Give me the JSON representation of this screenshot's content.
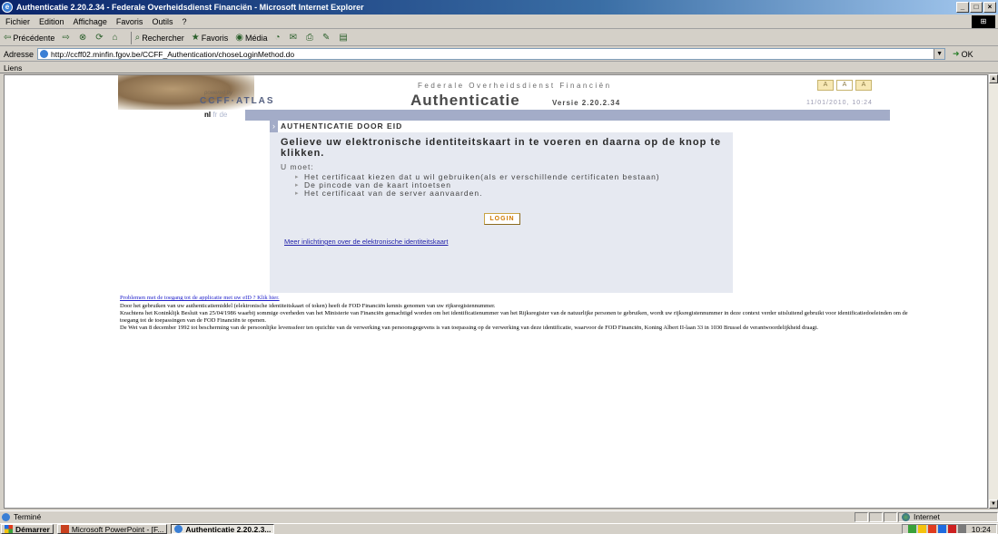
{
  "window": {
    "title": "Authenticatie 2.20.2.34 - Federale Overheidsdienst Financiën - Microsoft Internet Explorer",
    "controls": [
      "_",
      "□",
      "×"
    ]
  },
  "menu": [
    "Fichier",
    "Edition",
    "Affichage",
    "Favoris",
    "Outils",
    "?"
  ],
  "toolbar": {
    "back": "Précédente",
    "search": "Rechercher",
    "favorites": "Favoris",
    "media": "Média"
  },
  "address": {
    "label": "Adresse",
    "url": "http://ccff02.minfin.fgov.be/CCFF_Authentication/choseLoginMethod.do",
    "go": "OK"
  },
  "links_label": "Liens",
  "banner": {
    "powered_by": "powered by",
    "brand": "CCFF·ATLAS",
    "agency": "Federale Overheidsdienst Financiën",
    "title": "Authenticatie",
    "version": "Versie 2.20.2.34",
    "font_sizes": [
      "A",
      "A",
      "A"
    ],
    "date": "11/01/2010, 10:24",
    "languages": {
      "nl": "nl",
      "fr": "fr",
      "de": "de"
    }
  },
  "panel": {
    "title": "AUTHENTICATIE DOOR EID",
    "instruction": "Gelieve uw elektronische identiteitskaart in te voeren en daarna op de knop te klikken.",
    "must_label": "U moet:",
    "steps": [
      "Het certificaat kiezen dat u wil gebruiken(als er verschillende certificaten bestaan)",
      "De pincode van de kaart intoetsen",
      "Het certificaat van de server aanvaarden."
    ],
    "login_button": "LOGIN",
    "more_info_link": "Meer inlichtingen over de elektronische identiteitskaart"
  },
  "legal": {
    "problem_link": "Problemen met de toegang tot de applicatie met uw eID ? Klik hier.",
    "p1": "Door het gebruiken van uw authenticatiemiddel (elektronische identiteitskaart of token) heeft de FOD Financiën kennis genomen van uw rijksregistennummer.",
    "p2": "Krachtens het Koninklijk Besluit van 25/04/1986 waarbij sommige overheden van het Ministerie van Financiën gemachtigd worden om het identificatienummer van het Rijksregister van de natuurlijke personen te gebruiken, wordt uw rijksregistennummer in deze context verder uitsluitend gebruikt voor identificatiedoeleinden om de toegang tot de toepassingen van de FOD Financiën te openen.",
    "p3": "De Wet van 8 december 1992 tot bescherming van de persoonlijke levenssfeer ten opzichte van de verwerking van persoonsgegevens is van toepassing op de verwerking van deze identificatie, waarvoor de FOD Financiën, Koning Albert II-laan 33 in 1030 Brussel de verantwoordelijkheid draagt."
  },
  "status": {
    "text": "Terminé",
    "zone": "Internet"
  },
  "taskbar": {
    "start": "Démarrer",
    "tasks": [
      "Microsoft PowerPoint - [F...",
      "Authenticatie 2.20.2.3..."
    ],
    "clock": "10:24"
  },
  "colors": {
    "titlebar": "#0a246a",
    "panel_bg": "#e6e9f1",
    "accent_strip": "#a3acc8",
    "login_text": "#d07a00",
    "link": "#2222aa"
  }
}
